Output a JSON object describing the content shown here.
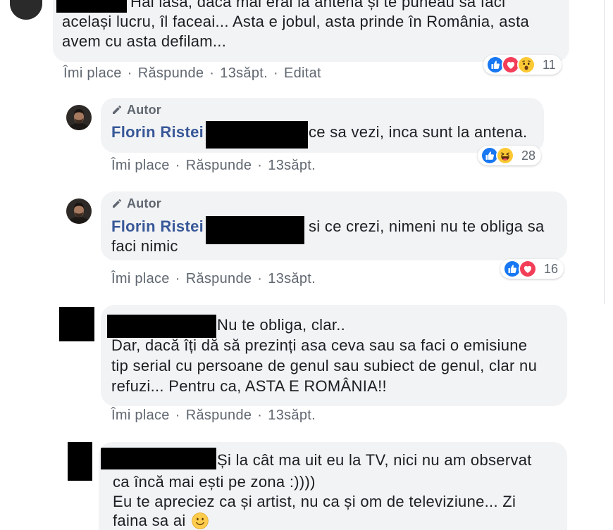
{
  "ui": {
    "separator": "·"
  },
  "colors": {
    "bubble": "#f2f3f5",
    "text": "#1c1e21",
    "author_name": "#385898",
    "meta_text": "#606770",
    "like": "#1877f2",
    "love": "#f33e58",
    "wow_haha": "#fcc934",
    "redaction": "#000000"
  },
  "comments": [
    {
      "lines": [
        "Hai lasa, daca mai erai la antena și te puneau sa faci",
        "același lucru, îl faceai... Asta e jobul, asta prinde în România, asta",
        "avem cu asta defilam..."
      ],
      "reactions": {
        "icons": [
          "like-icon",
          "love-icon",
          "wow-icon"
        ],
        "count": "11"
      },
      "actions": {
        "like": "Îmi place",
        "reply": "Răspunde",
        "time": "13săpt.",
        "edited": "Editat"
      }
    },
    {
      "badge": "Autor",
      "author": "Florin Ristei",
      "lines": [
        "ce sa vezi, inca sunt la antena."
      ],
      "reactions": {
        "icons": [
          "like-icon",
          "haha-icon"
        ],
        "count": "28"
      },
      "actions": {
        "like": "Îmi place",
        "reply": "Răspunde",
        "time": "13săpt."
      }
    },
    {
      "badge": "Autor",
      "author": "Florin Ristei",
      "lines": [
        "si ce crezi, nimeni nu te obliga sa",
        "faci nimic"
      ],
      "reactions": {
        "icons": [
          "like-icon",
          "love-icon"
        ],
        "count": "16"
      },
      "actions": {
        "like": "Îmi place",
        "reply": "Răspunde",
        "time": "13săpt."
      }
    },
    {
      "lines": [
        "Nu te obliga, clar..",
        "Dar, dacă îți dă să prezinți asa ceva sau sa faci o emisiune",
        "tip serial cu persoane de genul sau subiect de genul, clar nu",
        "refuzi... Pentru ca, ASTA E ROMÂNIA!!"
      ],
      "actions": {
        "like": "Îmi place",
        "reply": "Răspunde",
        "time": "13săpt."
      }
    },
    {
      "lines": [
        "Și la cât ma uit eu la TV, nici nu am observat",
        "ca încă mai ești pe zona :))))",
        "Eu te apreciez ca și artist, nu ca și om de televiziune... Zi",
        "faina sa ai"
      ],
      "trailing_emoji": "slightly-smiling-face-icon"
    }
  ]
}
